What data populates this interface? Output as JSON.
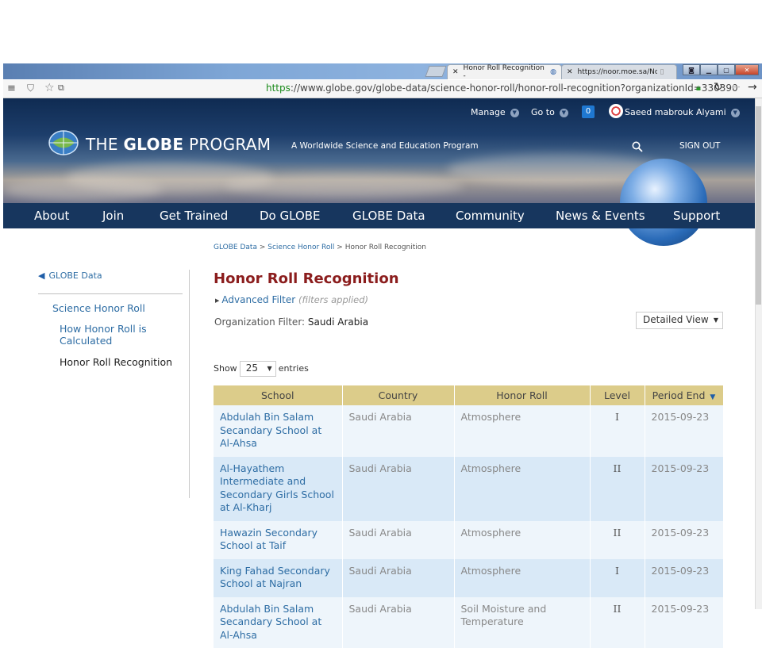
{
  "browser": {
    "tabs": [
      {
        "label": "Honor Roll Recognition - "
      },
      {
        "label": "https://noor.moe.sa/Noor"
      }
    ],
    "url_scheme": "https",
    "url_rest": "://www.globe.gov/globe-data/science-honor-roll/honor-roll-recognition?organizationId=330390"
  },
  "header": {
    "manage": "Manage",
    "goto": "Go to",
    "notifications": "0",
    "user": "Saeed mabrouk Alyami",
    "logo_prefix": "THE ",
    "logo_bold": "GLOBE",
    "logo_suffix": " PROGRAM",
    "tagline": "A Worldwide Science and Education Program",
    "signout": "SIGN OUT"
  },
  "nav": [
    "About",
    "Join",
    "Get Trained",
    "Do GLOBE",
    "GLOBE Data",
    "Community",
    "News & Events",
    "Support"
  ],
  "sidebar": {
    "back": "GLOBE Data",
    "items": [
      "Science Honor Roll",
      "How Honor Roll is Calculated",
      "Honor Roll Recognition"
    ]
  },
  "main": {
    "breadcrumb": [
      "GLOBE Data",
      "Science Honor Roll",
      "Honor Roll Recognition"
    ],
    "title": "Honor Roll Recognition",
    "advanced_filter": "Advanced Filter",
    "filters_note": "(filters applied)",
    "org_filter_label": "Organization Filter:",
    "org_filter_value": "Saudi Arabia",
    "view_select": "Detailed View",
    "show_label": "Show",
    "page_size": "25",
    "entries_label": "entries"
  },
  "table": {
    "headers": [
      "School",
      "Country",
      "Honor Roll",
      "Level",
      "Period End"
    ],
    "rows": [
      {
        "school": "Abdulah Bin Salam Secandary School at Al-Ahsa",
        "country": "Saudi Arabia",
        "honor": "Atmosphere",
        "level": "I",
        "period": "2015-09-23"
      },
      {
        "school": "Al-Hayathem Intermediate and Secondary Girls School at Al-Kharj",
        "country": "Saudi Arabia",
        "honor": "Atmosphere",
        "level": "II",
        "period": "2015-09-23"
      },
      {
        "school": "Hawazin Secondary School at Taif",
        "country": "Saudi Arabia",
        "honor": "Atmosphere",
        "level": "II",
        "period": "2015-09-23"
      },
      {
        "school": "King Fahad Secondary School at Najran",
        "country": "Saudi Arabia",
        "honor": "Atmosphere",
        "level": "I",
        "period": "2015-09-23"
      },
      {
        "school": "Abdulah Bin Salam Secandary School at Al-Ahsa",
        "country": "Saudi Arabia",
        "honor": "Soil Moisture and Temperature",
        "level": "II",
        "period": "2015-09-23"
      }
    ]
  }
}
